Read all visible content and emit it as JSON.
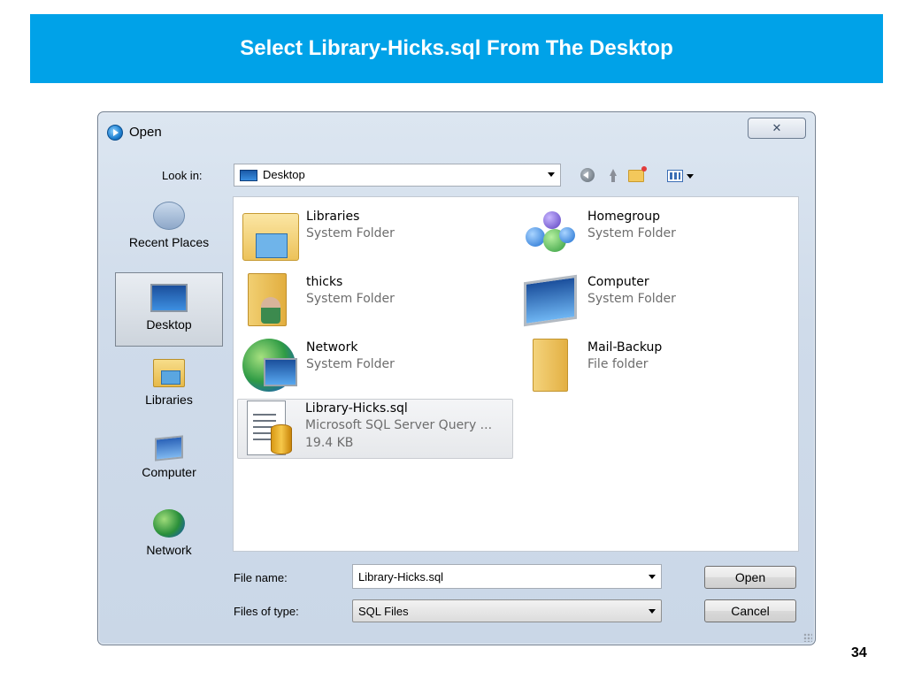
{
  "slide": {
    "title": "Select Library-Hicks.sql From The Desktop",
    "page_number": "34",
    "banner_color": "#00a2e8"
  },
  "dialog": {
    "title": "Open",
    "close_glyph": "✕",
    "look_in_label": "Look in:",
    "look_in_value": "Desktop",
    "toolbar_icons": [
      "back-icon",
      "up-folder-icon",
      "new-folder-icon",
      "views-menu-icon"
    ],
    "places": [
      {
        "label": "Recent Places",
        "icon": "recent-places-icon"
      },
      {
        "label": "Desktop",
        "icon": "desktop-icon",
        "selected": true
      },
      {
        "label": "Libraries",
        "icon": "libraries-icon"
      },
      {
        "label": "Computer",
        "icon": "computer-icon"
      },
      {
        "label": "Network",
        "icon": "network-icon"
      }
    ],
    "items": [
      {
        "name": "Libraries",
        "type": "System Folder",
        "icon": "libraries-folder-icon"
      },
      {
        "name": "Homegroup",
        "type": "System Folder",
        "icon": "homegroup-icon"
      },
      {
        "name": "thicks",
        "type": "System Folder",
        "icon": "user-folder-icon"
      },
      {
        "name": "Computer",
        "type": "System Folder",
        "icon": "computer-icon"
      },
      {
        "name": "Network",
        "type": "System Folder",
        "icon": "network-icon"
      },
      {
        "name": "Mail-Backup",
        "type": "File folder",
        "icon": "folder-icon"
      },
      {
        "name": "Library-Hicks.sql",
        "type": "Microsoft SQL Server Query ...",
        "size": "19.4 KB",
        "icon": "sql-file-icon",
        "selected": true
      }
    ],
    "file_name_label": "File name:",
    "file_name_value": "Library-Hicks.sql",
    "file_type_label": "Files of type:",
    "file_type_value": "SQL Files",
    "open_button": "Open",
    "cancel_button": "Cancel"
  }
}
